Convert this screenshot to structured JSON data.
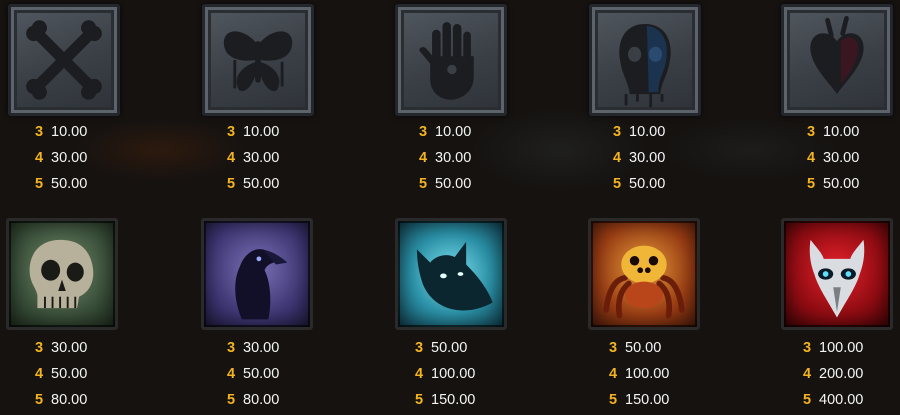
{
  "colors": {
    "count_accent": "#f3b320",
    "amount_text": "#f4f4f4",
    "background": "#151210"
  },
  "symbols": [
    {
      "icon": "crossed-bones-icon",
      "pays": [
        {
          "count": "3",
          "amount": "10.00"
        },
        {
          "count": "4",
          "amount": "30.00"
        },
        {
          "count": "5",
          "amount": "50.00"
        }
      ]
    },
    {
      "icon": "butterfly-icon",
      "pays": [
        {
          "count": "3",
          "amount": "10.00"
        },
        {
          "count": "4",
          "amount": "30.00"
        },
        {
          "count": "5",
          "amount": "50.00"
        }
      ]
    },
    {
      "icon": "hand-icon",
      "pays": [
        {
          "count": "3",
          "amount": "10.00"
        },
        {
          "count": "4",
          "amount": "30.00"
        },
        {
          "count": "5",
          "amount": "50.00"
        }
      ]
    },
    {
      "icon": "skull-mask-icon",
      "pays": [
        {
          "count": "3",
          "amount": "10.00"
        },
        {
          "count": "4",
          "amount": "30.00"
        },
        {
          "count": "5",
          "amount": "50.00"
        }
      ]
    },
    {
      "icon": "heart-icon",
      "pays": [
        {
          "count": "3",
          "amount": "10.00"
        },
        {
          "count": "4",
          "amount": "30.00"
        },
        {
          "count": "5",
          "amount": "50.00"
        }
      ]
    },
    {
      "icon": "skull-icon",
      "pays": [
        {
          "count": "3",
          "amount": "30.00"
        },
        {
          "count": "4",
          "amount": "50.00"
        },
        {
          "count": "5",
          "amount": "80.00"
        }
      ]
    },
    {
      "icon": "raven-icon",
      "pays": [
        {
          "count": "3",
          "amount": "30.00"
        },
        {
          "count": "4",
          "amount": "50.00"
        },
        {
          "count": "5",
          "amount": "80.00"
        }
      ]
    },
    {
      "icon": "wolf-icon",
      "pays": [
        {
          "count": "3",
          "amount": "50.00"
        },
        {
          "count": "4",
          "amount": "100.00"
        },
        {
          "count": "5",
          "amount": "150.00"
        }
      ]
    },
    {
      "icon": "spider-icon",
      "pays": [
        {
          "count": "3",
          "amount": "50.00"
        },
        {
          "count": "4",
          "amount": "100.00"
        },
        {
          "count": "5",
          "amount": "150.00"
        }
      ]
    },
    {
      "icon": "demon-skull-icon",
      "pays": [
        {
          "count": "3",
          "amount": "100.00"
        },
        {
          "count": "4",
          "amount": "200.00"
        },
        {
          "count": "5",
          "amount": "400.00"
        }
      ]
    }
  ]
}
